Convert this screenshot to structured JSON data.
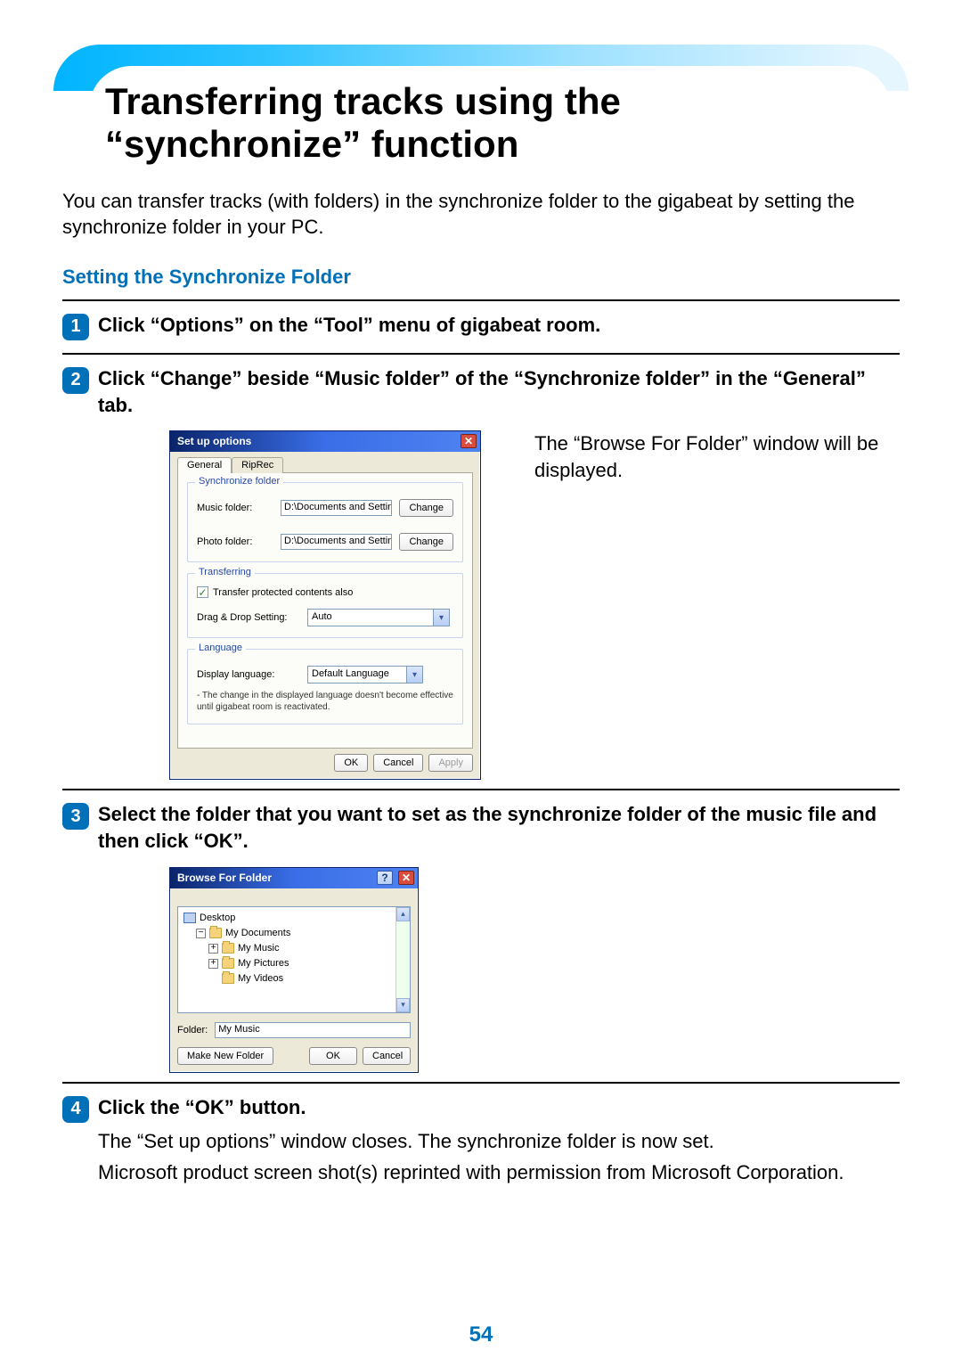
{
  "page": {
    "title": "Transferring tracks using the “synchronize” function",
    "intro": "You can transfer tracks (with folders) in the synchronize folder to the gigabeat by setting the synchronize folder in your PC.",
    "subhead": "Setting the Synchronize Folder",
    "page_number": "54"
  },
  "steps": {
    "s1": {
      "num": "1",
      "title": "Click “Options” on the “Tool” menu of gigabeat room."
    },
    "s2": {
      "num": "2",
      "title": "Click “Change” beside “Music folder” of the “Synchronize folder” in the “General” tab.",
      "side_note": "The “Browse For Folder” window will be displayed."
    },
    "s3": {
      "num": "3",
      "title": "Select the folder that you want to set as the synchronize folder of the music file and then click “OK”."
    },
    "s4": {
      "num": "4",
      "title": "Click the “OK” button.",
      "body1": "The “Set up options” window closes. The synchronize folder is now set.",
      "body2": "Microsoft product screen shot(s) reprinted with permission from Microsoft Corporation."
    }
  },
  "dlg_options": {
    "title": "Set up options",
    "tabs": {
      "general": "General",
      "riprec": "RipRec"
    },
    "sync": {
      "legend": "Synchronize folder",
      "music_label": "Music folder:",
      "music_path": "D:\\Documents and Settings\\engxp\\My",
      "photo_label": "Photo folder:",
      "photo_path": "D:\\Documents and Settings\\engxp\\My",
      "change": "Change"
    },
    "transfer": {
      "legend": "Transferring",
      "chk_label": "Transfer protected contents also",
      "dragdrop_label": "Drag & Drop Setting:",
      "dragdrop_value": "Auto"
    },
    "language": {
      "legend": "Language",
      "display_label": "Display language:",
      "display_value": "Default Language",
      "note": "- The change in the displayed language doesn't become effective until gigabeat room is reactivated."
    },
    "buttons": {
      "ok": "OK",
      "cancel": "Cancel",
      "apply": "Apply"
    }
  },
  "dlg_browse": {
    "title": "Browse For Folder",
    "tree": {
      "desktop": "Desktop",
      "mydocs": "My Documents",
      "mymusic": "My Music",
      "mypics": "My Pictures",
      "myvideos": "My Videos"
    },
    "folder_label": "Folder:",
    "folder_value": "My Music",
    "buttons": {
      "make": "Make New Folder",
      "ok": "OK",
      "cancel": "Cancel"
    }
  }
}
